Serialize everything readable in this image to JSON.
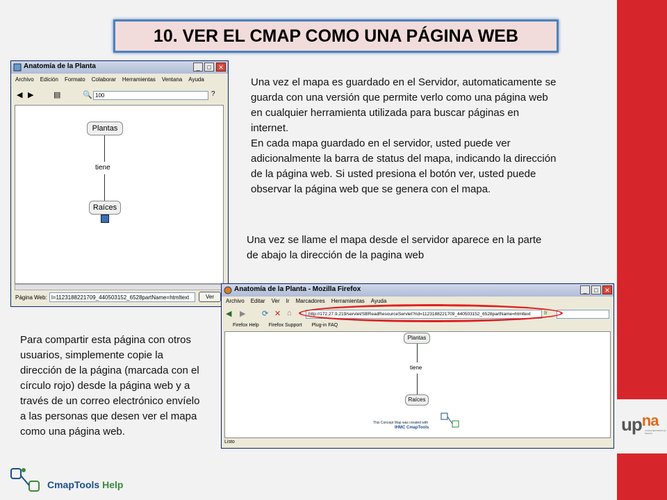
{
  "slide": {
    "title": "10. VER EL CMAP COMO UNA PÁGINA WEB",
    "paragraph_1": "Una vez el mapa es guardado en el Servidor, automaticamente se guarda con una versión que permite verlo como una página web en cualquier herramienta utilizada para buscar páginas en internet.",
    "paragraph_2": "En cada mapa guardado en el servidor, usted puede ver adicionalmente la barra de status del mapa, indicando la dirección de la página web. Si usted presiona el botón ver, usted puede observar la página web que se genera con el mapa.",
    "paragraph_3": "Una vez se llame el mapa desde el servidor aparece en la parte de abajo la dirección de la pagina web",
    "paragraph_4": "Para compartir esta página con otros usuarios, simplemente copie la dirección de la página (marcada con el círculo rojo) desde la página web y a través de un correo electrónico envíelo a las personas que desen ver el mapa como una página web."
  },
  "cmap_window": {
    "title": "Anatomía de la Planta",
    "menu": [
      "Archivo",
      "Edición",
      "Formato",
      "Colaborar",
      "Herramientas",
      "Ventana",
      "Ayuda"
    ],
    "zoom": "100",
    "nodes": {
      "top": "Plantas",
      "link": "tiene",
      "bottom": "Raíces"
    },
    "status_label": "Página Web:",
    "status_url": "l=1123188221709_440503152_6528partName=htmltext",
    "view_button": "Ver"
  },
  "browser_window": {
    "title": "Anatomía de la Planta - Mozilla Firefox",
    "menu": [
      "Archivo",
      "Editar",
      "Ver",
      "Ir",
      "Marcadores",
      "Herramientas",
      "Ayuda"
    ],
    "url": "http://172.27.9.219/servlet/SBReadResourceServlet?rid=1123188221709_440503152_6528partName=htmltext",
    "go_label": "Ir",
    "bookmarks": [
      "Firefox Help",
      "Firefox Support",
      "Plug-in FAQ"
    ],
    "nodes": {
      "top": "Plantas",
      "link": "tiene",
      "bottom": "Raíces"
    },
    "created_with_1": "This Concept Map was created with",
    "created_with_2": "IHMC CmapTools",
    "status": "Listo"
  },
  "footer_logo": {
    "main": "CmapTools",
    "help": "Help"
  },
  "brand": {
    "upna_1": "up",
    "upna_2": "na",
    "upna_sub": "Universidad Pública de Navarra"
  },
  "colors": {
    "accent_red": "#d7262b",
    "title_border": "#4f81bd",
    "title_fill": "#f2dcdb"
  }
}
